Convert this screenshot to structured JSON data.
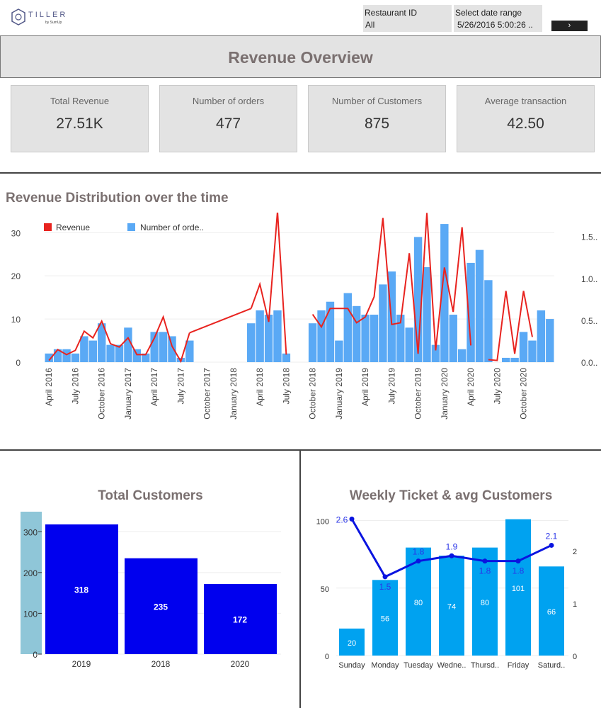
{
  "header": {
    "logo_text": "TILLER",
    "logo_sub": "by SumUp",
    "restaurant_filter": {
      "label": "Restaurant ID",
      "value": "All"
    },
    "date_filter": {
      "label": "Select date range",
      "value": "5/26/2016 5:00:26 .."
    },
    "go_button": "›"
  },
  "page_title": "Revenue Overview",
  "kpis": [
    {
      "label": "Total Revenue",
      "value": "27.51K"
    },
    {
      "label": "Number of orders",
      "value": "477"
    },
    {
      "label": "Number of Customers",
      "value": "875"
    },
    {
      "label": "Average transaction",
      "value": "42.50"
    }
  ],
  "colors": {
    "revenue": "#e8231f",
    "orders": "#5aa9f5",
    "customers_bar": "#0000ee",
    "weekly_bar": "#00a2f0",
    "weekly_line": "#0a14e0"
  },
  "chart_data": [
    {
      "type": "bar+line",
      "title": "Revenue Distribution over the time",
      "legend": [
        "Revenue",
        "Number of orde.."
      ],
      "legend_position": "top-left",
      "x_ticks": [
        "April 2016",
        "July 2016",
        "October 2016",
        "January 2017",
        "April 2017",
        "July 2017",
        "October 2017",
        "January 2018",
        "April 2018",
        "July 2018",
        "October 2018",
        "January 2019",
        "April 2019",
        "July 2019",
        "October 2019",
        "January 2020",
        "April 2020",
        "July 2020",
        "October 2020"
      ],
      "y_ticks_left": [
        "0",
        "10",
        "20",
        "30"
      ],
      "y_ticks_right": [
        "0.0..",
        "0.5..",
        "1.0..",
        "1.5.."
      ],
      "ylim_left": [
        0,
        33
      ],
      "ylim_right": [
        0,
        1.7
      ],
      "months_from": "April 2016",
      "series": [
        {
          "name": "Number of orde..",
          "type": "bar",
          "values": [
            2,
            3,
            3,
            2,
            6,
            5,
            9,
            4,
            4,
            8,
            3,
            2,
            7,
            7,
            6,
            1,
            5,
            null,
            null,
            null,
            null,
            null,
            null,
            9,
            12,
            11,
            12,
            2,
            null,
            null,
            9,
            12,
            14,
            5,
            16,
            13,
            11,
            11,
            18,
            21,
            11,
            8,
            29,
            22,
            4,
            32,
            11,
            3,
            23,
            26,
            19,
            null,
            1,
            1,
            7,
            5,
            12,
            10
          ]
        },
        {
          "name": "Revenue",
          "type": "line",
          "values": [
            0.02,
            0.15,
            0.09,
            0.14,
            0.37,
            0.29,
            0.49,
            0.22,
            0.18,
            0.29,
            0.09,
            0.09,
            0.29,
            0.54,
            0.19,
            0.01,
            0.35,
            null,
            null,
            null,
            null,
            null,
            null,
            0.64,
            0.93,
            0.48,
            1.8,
            0.09,
            null,
            null,
            0.57,
            0.42,
            0.64,
            0.64,
            0.64,
            0.47,
            0.54,
            0.78,
            1.72,
            0.45,
            0.47,
            1.3,
            0.1,
            1.78,
            0.14,
            1.13,
            0.6,
            1.61,
            0.2,
            null,
            0.03,
            0.02,
            0.85,
            0.1,
            0.85,
            0.3
          ]
        }
      ]
    },
    {
      "type": "bar",
      "title": "Total Customers",
      "categories": [
        "2019",
        "2018",
        "2020"
      ],
      "values": [
        318,
        235,
        172
      ],
      "y_ticks": [
        "0",
        "100",
        "200",
        "300"
      ],
      "ylim": [
        0,
        330
      ]
    },
    {
      "type": "bar+line",
      "title": "Weekly Ticket & avg Customers",
      "categories": [
        "Sunday",
        "Monday",
        "Tuesday",
        "Wedne..",
        "Thursd..",
        "Friday",
        "Saturd.."
      ],
      "bar_values": [
        20,
        56,
        80,
        74,
        80,
        101,
        66
      ],
      "line_values": [
        2.6,
        1.5,
        1.8,
        1.9,
        1.8,
        1.8,
        2.1
      ],
      "y_ticks_left": [
        "0",
        "50",
        "100"
      ],
      "y_ticks_right": [
        "0",
        "1",
        "2"
      ],
      "ylim_left": [
        0,
        105
      ],
      "ylim_right": [
        0,
        2.7
      ]
    }
  ]
}
